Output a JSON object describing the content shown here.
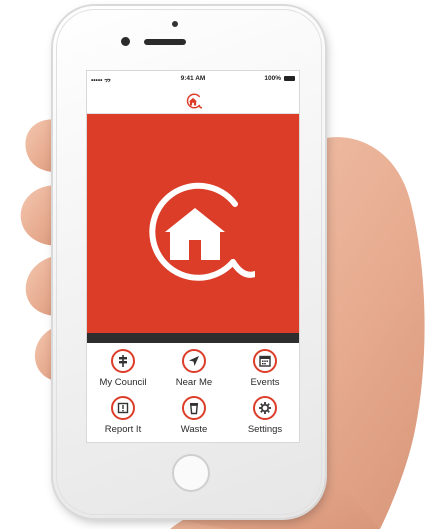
{
  "status_bar": {
    "signal": "••••• ᯄ",
    "time": "9:41 AM",
    "battery": "100%"
  },
  "header": {
    "logo": "house-in-circle-icon"
  },
  "hero": {
    "logo": "house-in-circle-icon",
    "color": "#dc3d29"
  },
  "menu": {
    "items": [
      {
        "label": "My Council",
        "icon": "signpost-icon"
      },
      {
        "label": "Near Me",
        "icon": "location-arrow-icon"
      },
      {
        "label": "Events",
        "icon": "calendar-icon"
      },
      {
        "label": "Report It",
        "icon": "alert-icon"
      },
      {
        "label": "Waste",
        "icon": "bin-icon"
      },
      {
        "label": "Settings",
        "icon": "gear-icon"
      }
    ]
  },
  "colors": {
    "accent": "#dc3d29",
    "band": "#2e2e2e"
  }
}
